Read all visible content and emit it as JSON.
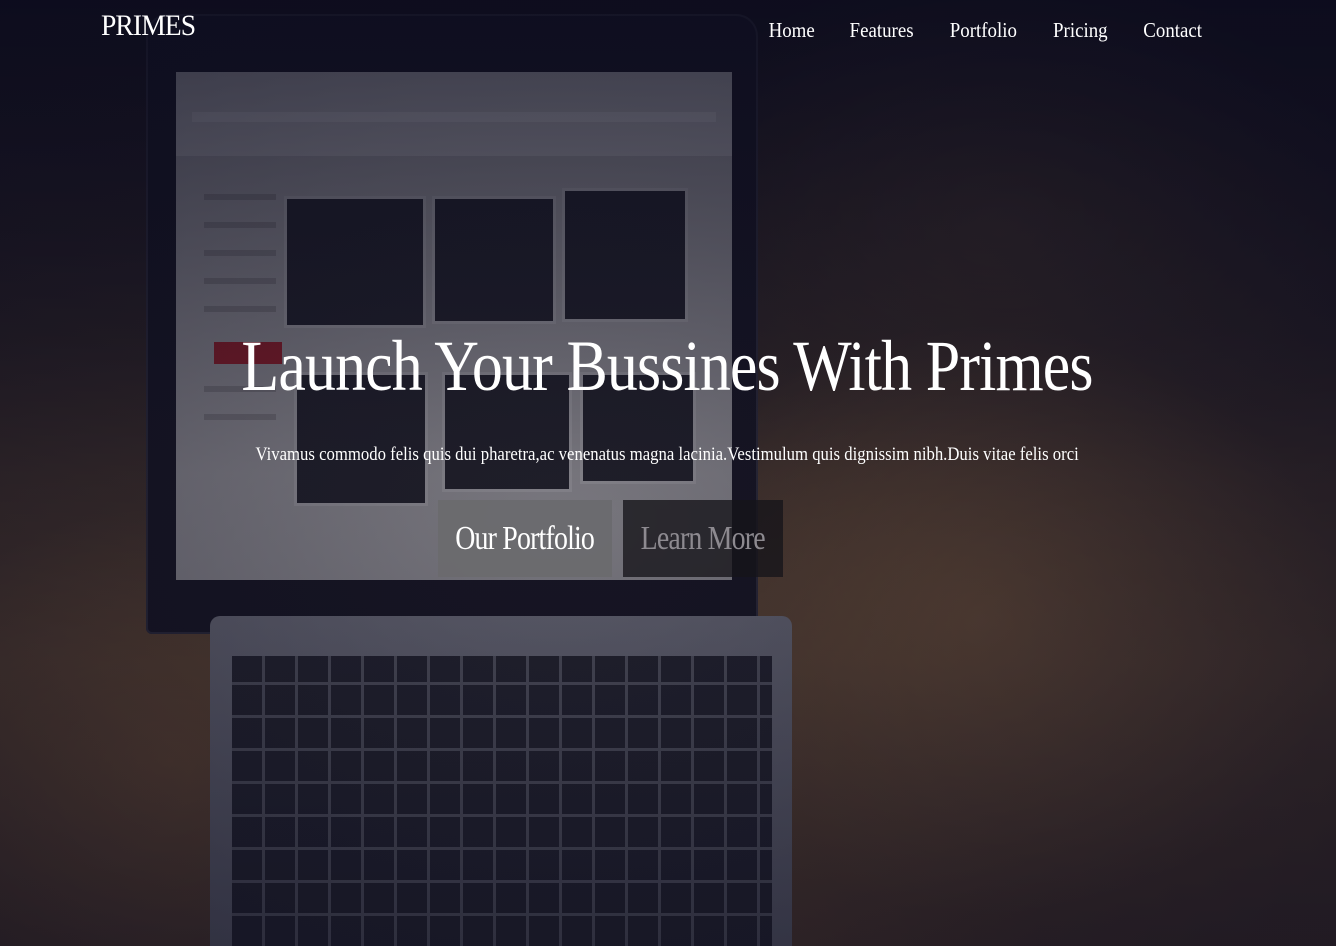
{
  "navbar": {
    "brand": "PRIMES",
    "links": [
      "Home",
      "Features",
      "Portfolio",
      "Pricing",
      "Contact"
    ]
  },
  "hero": {
    "title": "Launch Your Bussines With Primes",
    "subtitle": "Vivamus commodo  felis quis dui pharetra,ac venenatus magna lacinia.Vestimulum quis dignissim nibh.Duis vitae felis orci",
    "buttons": {
      "primary_label": "Our Portfolio",
      "secondary_label": "Learn More"
    }
  },
  "colors": {
    "overlay": "#080a1c",
    "primary_button": "#6a6a6e",
    "secondary_button": "#16141a",
    "secondary_button_text": "#8d8a90"
  }
}
